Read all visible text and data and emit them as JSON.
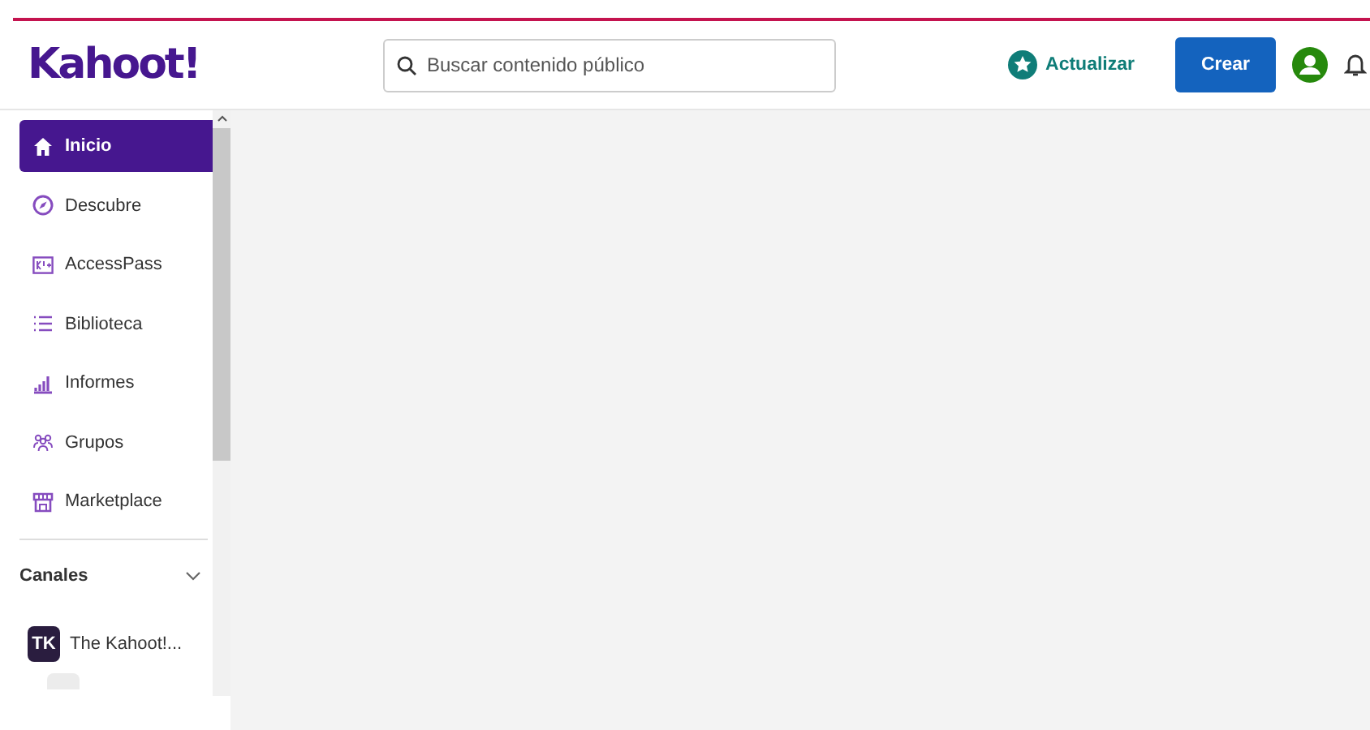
{
  "header": {
    "logo": "Kahoot!",
    "search": {
      "placeholder": "Buscar contenido público"
    },
    "upgrade": "Actualizar",
    "create": "Crear"
  },
  "sidebar": {
    "items": [
      {
        "label": "Inicio",
        "kind": "home",
        "selected": true
      },
      {
        "label": "Descubre",
        "kind": "discover",
        "selected": false
      },
      {
        "label": "AccessPass",
        "kind": "pass",
        "selected": false
      },
      {
        "label": "Biblioteca",
        "kind": "library",
        "selected": false
      },
      {
        "label": "Informes",
        "kind": "reports",
        "selected": false
      },
      {
        "label": "Grupos",
        "kind": "groups",
        "selected": false
      },
      {
        "label": "Marketplace",
        "kind": "market",
        "selected": false
      }
    ],
    "channels": {
      "title": "Canales",
      "expanded": false,
      "items": [
        {
          "initials": "TK",
          "name": "The Kahoot!..."
        }
      ]
    }
  }
}
